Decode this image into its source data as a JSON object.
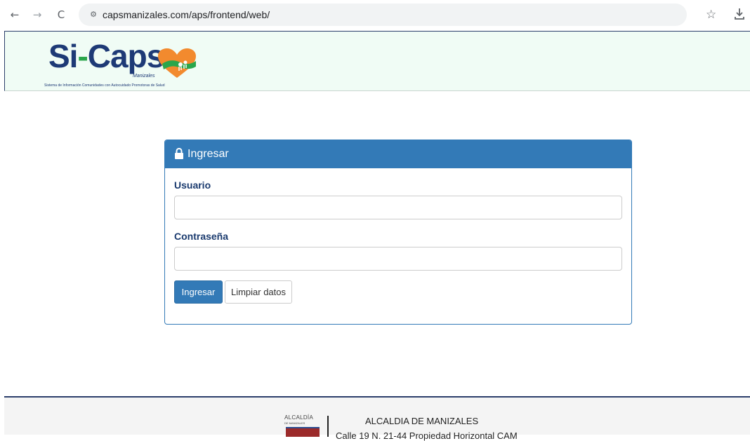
{
  "browser": {
    "url": "capsmanizales.com/aps/frontend/web/",
    "back_icon": "←",
    "forward_icon": "→",
    "reload_icon": "C",
    "site_info_icon": "⚙",
    "star_icon": "☆"
  },
  "header": {
    "logo_si": "Si",
    "logo_dash": "-",
    "logo_caps": "Caps",
    "logo_city": "Manizales",
    "tagline": "Sistema de Información Comunidades con Autocuidado Promotoras de Salud"
  },
  "login": {
    "title": "Ingresar",
    "username_label": "Usuario",
    "username_value": "",
    "password_label": "Contraseña",
    "password_value": "",
    "submit_label": "Ingresar",
    "clear_label": "Limpiar datos",
    "accent_color": "#337ab7"
  },
  "footer": {
    "crest_line1": "ALCALDÍA",
    "crest_line2": "DE MANIZALES",
    "org_name": "ALCALDIA DE MANIZALES",
    "address": "Calle 19 N. 21-44 Propiedad Horizontal CAM"
  }
}
